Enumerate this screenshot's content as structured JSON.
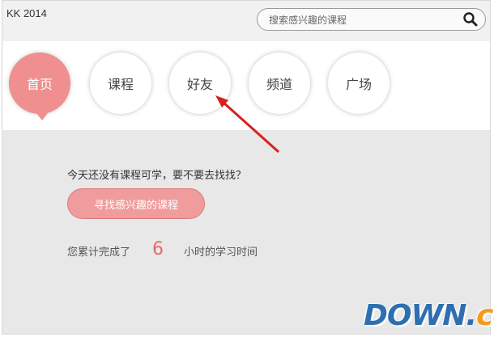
{
  "app": {
    "title": "KK 2014"
  },
  "search": {
    "placeholder": "搜索感兴趣的课程",
    "icon": "search-icon"
  },
  "nav": {
    "items": [
      {
        "label": "首页",
        "active": true
      },
      {
        "label": "课程",
        "active": false
      },
      {
        "label": "好友",
        "active": false
      },
      {
        "label": "频道",
        "active": false
      },
      {
        "label": "广场",
        "active": false
      }
    ]
  },
  "content": {
    "prompt": "今天还没有课程可学，要不要去找找？",
    "find_button": "寻找感兴趣的课程",
    "stats_prefix": "您累计完成了",
    "stats_hours": "6",
    "stats_suffix": "小时的学习时间"
  },
  "watermark": {
    "main": "DOWN",
    "dot": ".",
    "suffix": "cc"
  },
  "colors": {
    "accent": "#ef8f8f",
    "button": "#f19c9c",
    "hours": "#e36b6b",
    "arrow": "#d62020",
    "watermark_blue": "#2e6fb0",
    "watermark_orange": "#f29c1f"
  }
}
